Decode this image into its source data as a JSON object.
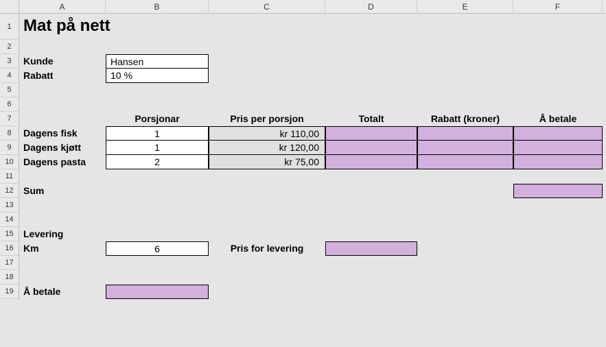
{
  "columns": [
    "A",
    "B",
    "C",
    "D",
    "E",
    "F"
  ],
  "rows": [
    "1",
    "2",
    "3",
    "4",
    "5",
    "6",
    "7",
    "8",
    "9",
    "10",
    "11",
    "12",
    "13",
    "14",
    "15",
    "16",
    "17",
    "18",
    "19"
  ],
  "title": "Mat på nett",
  "customer": {
    "label": "Kunde",
    "value": "Hansen"
  },
  "discount": {
    "label": "Rabatt",
    "value": "10 %"
  },
  "table": {
    "headers": {
      "portions": "Porsjonar",
      "price_per": "Pris per porsjon",
      "total": "Totalt",
      "discount_kr": "Rabatt (kroner)",
      "to_pay": "Å betale"
    },
    "rows": [
      {
        "name": "Dagens fisk",
        "portions": "1",
        "price": "kr 110,00"
      },
      {
        "name": "Dagens kjøtt",
        "portions": "1",
        "price": "kr 120,00"
      },
      {
        "name": "Dagens pasta",
        "portions": "2",
        "price": "kr 75,00"
      }
    ]
  },
  "sum_label": "Sum",
  "delivery": {
    "label": "Levering",
    "km_label": "Km",
    "km_value": "6",
    "price_label": "Pris for levering"
  },
  "to_pay_label": "Å betale",
  "chart_data": {
    "type": "table",
    "title": "Mat på nett",
    "customer": "Hansen",
    "discount_percent": 10,
    "items": [
      {
        "name": "Dagens fisk",
        "portions": 1,
        "price_per_portion": 110.0
      },
      {
        "name": "Dagens kjøtt",
        "portions": 1,
        "price_per_portion": 120.0
      },
      {
        "name": "Dagens pasta",
        "portions": 2,
        "price_per_portion": 75.0
      }
    ],
    "delivery_km": 6
  }
}
